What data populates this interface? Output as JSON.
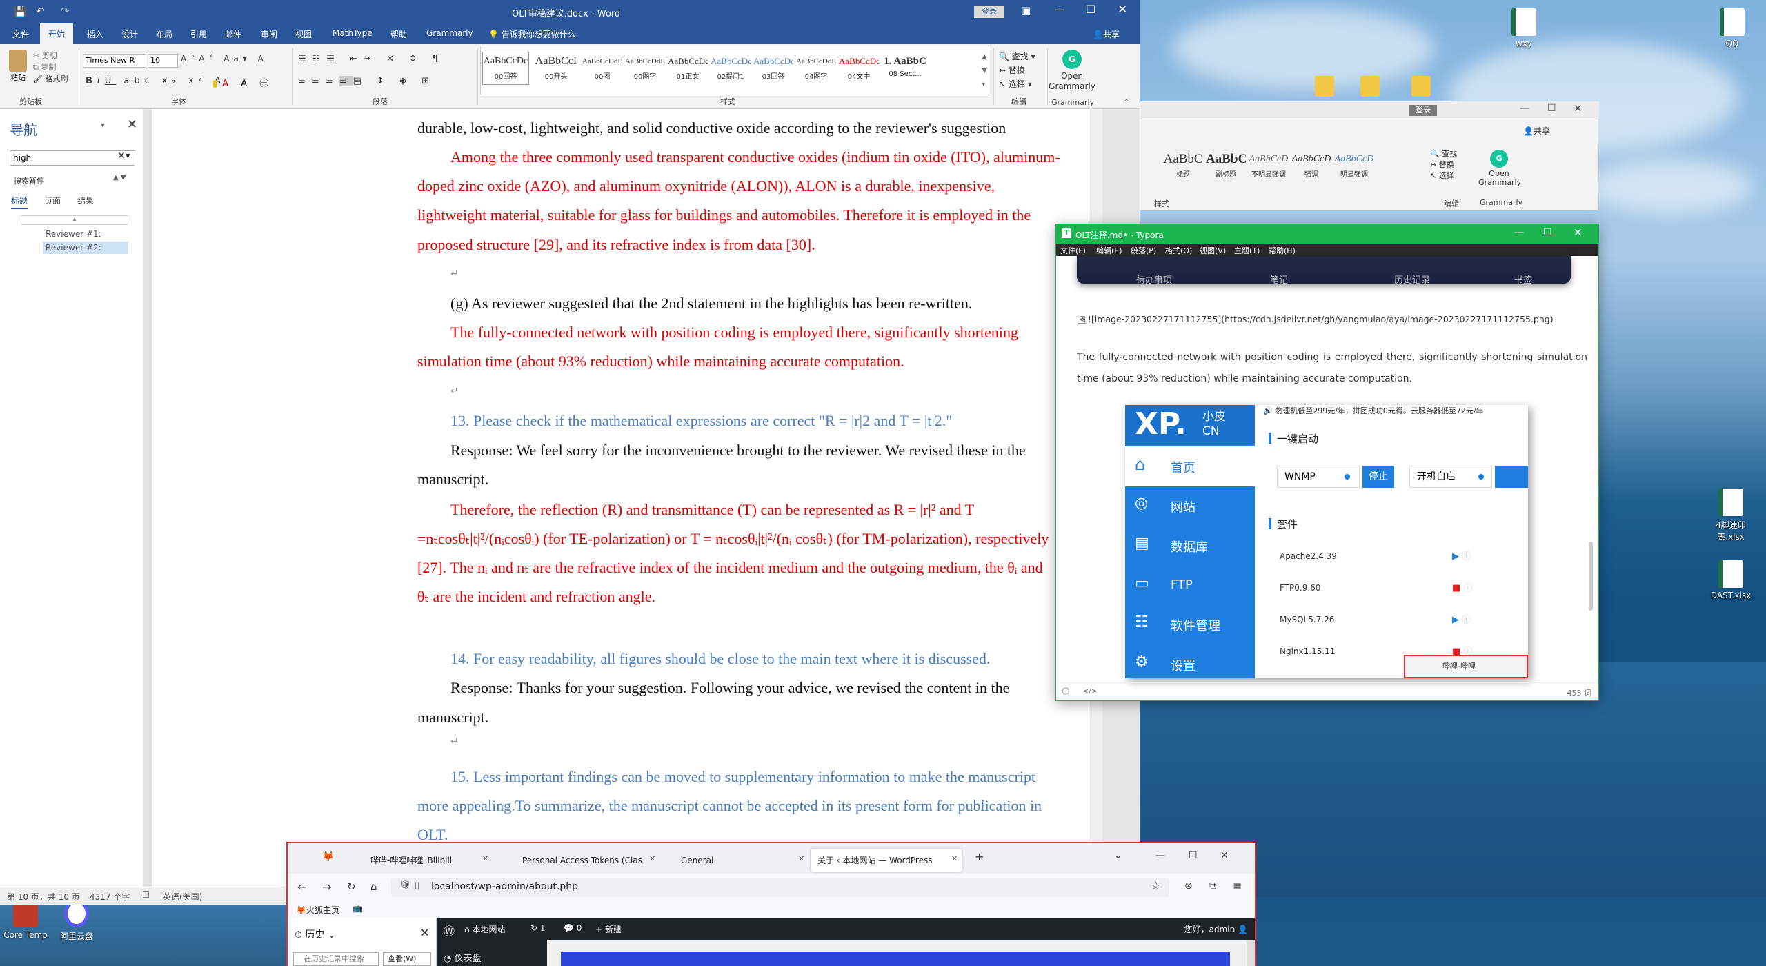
{
  "desktop": {
    "icons": [
      {
        "label": "wxy"
      },
      {
        "label": "QQ"
      },
      {
        "label": "4脚速印表.xlsx"
      },
      {
        "label": "DAST.xlsx"
      },
      {
        "label": "Core Temp"
      },
      {
        "label": "阿里云盘"
      }
    ]
  },
  "word": {
    "title": "OLT审稿建议.docx - Word",
    "login": "登录",
    "share": "共享",
    "tabs": [
      "文件",
      "开始",
      "插入",
      "设计",
      "布局",
      "引用",
      "邮件",
      "审阅",
      "视图",
      "MathType",
      "帮助",
      "Grammarly"
    ],
    "tell_me": "告诉我你想要做什么",
    "clipboard": {
      "paste": "粘贴",
      "cut": "剪切",
      "copy": "复制",
      "format_painter": "格式刷",
      "group": "剪贴板"
    },
    "font": {
      "name": "Times New R",
      "size": "10",
      "group": "字体"
    },
    "paragraph_group": "段落",
    "styles_group": "样式",
    "styles": [
      {
        "sample": "AaBbCcDc",
        "name": "00回答"
      },
      {
        "sample": "AaBbCcI",
        "name": "00开头"
      },
      {
        "sample": "AaBbCcDdE",
        "name": "00图"
      },
      {
        "sample": "AaBbCcDdE",
        "name": "00图字"
      },
      {
        "sample": "AaBbCcDc",
        "name": "01正文"
      },
      {
        "sample": "AaBbCcDc",
        "name": "02提问1"
      },
      {
        "sample": "AaBbCcDc",
        "name": "03回答"
      },
      {
        "sample": "AaBbCcDdE",
        "name": "04图字"
      },
      {
        "sample": "AaBbCcDc",
        "name": "04文中"
      },
      {
        "sample": "1. AaBbC",
        "name": "08 Sect..."
      }
    ],
    "editing": {
      "find": "查找",
      "replace": "替换",
      "select": "选择",
      "group": "编辑"
    },
    "grammarly": {
      "open": "Open Grammarly",
      "group": "Grammarly"
    },
    "nav": {
      "title": "导航",
      "search_value": "high",
      "search_paused": "搜索暂停",
      "tabs": [
        "标题",
        "页面",
        "结果"
      ],
      "headings": [
        "Reviewer #1:",
        "Reviewer #2:"
      ]
    },
    "doc": {
      "lines": [
        {
          "t": "durable, low-cost, lightweight, and solid conductive oxide  according to the reviewer's suggestion",
          "c": "black"
        },
        {
          "t": "Among the three commonly used transparent conductive oxides (indium tin oxide (ITO), aluminum-",
          "c": "red"
        },
        {
          "t": "doped  zinc  oxide  (AZO),  and  aluminum  oxynitride  (ALON)),  ALON  is  a  durable,  inexpensive,",
          "c": "red"
        },
        {
          "t": "lightweight material, suitable for glass for buildings and automobiles. Therefore it is employed in the",
          "c": "red"
        },
        {
          "t": "proposed structure [29], and its refractive index is from data [30].",
          "c": "red"
        },
        {
          "t": "(g) As reviewer suggested that the 2nd statement in the highlights has been re-written.",
          "c": "black"
        },
        {
          "t": "The  fully-connected  network  with  position  coding  is  employed  there,  significantly  shortening",
          "c": "red"
        },
        {
          "t": "simulation time (about 93% reduction) while maintaining accurate computation.",
          "c": "red"
        },
        {
          "t": "13. Please check if the mathematical expressions are correct \"R = |r|2 and T = |t|2.\"",
          "c": "blue"
        },
        {
          "t": "Response: We feel sorry for the inconvenience brought to the reviewer. We revised these in the",
          "c": "black"
        },
        {
          "t": "manuscript.",
          "c": "black"
        },
        {
          "t": "Therefore,  the  reflection  (R)  and  transmittance  (T)  can  be  represented  as  R  =  |r|²  and  T",
          "c": "red"
        },
        {
          "t": "=nₜcosθₜ|t|²/(nᵢcosθᵢ) (for TE-polarization) or T = nₜcosθᵢ|t|²/(nᵢ cosθₜ) (for TM-polarization), respectively",
          "c": "red"
        },
        {
          "t": "[27]. The nᵢ and nₜ are the refractive index of the incident medium and the outgoing medium, the θᵢ and",
          "c": "red"
        },
        {
          "t": "θₜ are the incident and refraction angle.",
          "c": "red"
        },
        {
          "t": "14. For easy readability, all figures should be close to the main text where it is discussed.",
          "c": "blue"
        },
        {
          "t": "Response: Thanks for your suggestion. Following your advice, we revised the content in the",
          "c": "black"
        },
        {
          "t": "manuscript.",
          "c": "black"
        },
        {
          "t": "15. Less important findings can be moved to supplementary information to make the manuscript",
          "c": "blue"
        },
        {
          "t": "more appealing.To summarize, the manuscript cannot be accepted in its present form for publication in",
          "c": "blue"
        },
        {
          "t": "OLT.",
          "c": "blue"
        }
      ]
    },
    "status": {
      "page": "第 10 页，共 10 页",
      "words": "4317 个字",
      "lang": "英语(美国)"
    }
  },
  "word2": {
    "login": "登录",
    "share": "共享",
    "styles": [
      {
        "sample": "AaBbC",
        "name": "标题"
      },
      {
        "sample": "AaBbC",
        "name": "副标题"
      },
      {
        "sample": "AaBbCcD",
        "name": "不明显强调"
      },
      {
        "sample": "AaBbCcD",
        "name": "强调"
      },
      {
        "sample": "AaBbCcD",
        "name": "明显强调"
      }
    ],
    "styles_group": "样式",
    "editing": {
      "find": "查找",
      "replace": "替换",
      "select": "选择",
      "group": "编辑"
    },
    "grammarly": {
      "open": "Open Grammarly",
      "group": "Grammarly"
    }
  },
  "typora": {
    "title": "OLT注释.md• - Typora",
    "menu": [
      "文件(F)",
      "编辑(E)",
      "段落(P)",
      "格式(O)",
      "视图(V)",
      "主题(T)",
      "帮助(H)"
    ],
    "top_labels": [
      "待办事项",
      "笔记",
      "历史记录",
      "书签"
    ],
    "image_link": "![image-20230227171112755](https://cdn.jsdelivr.net/gh/yangmulao/aya/image-20230227171112755.png)",
    "para": "The fully-connected network with position coding is employed there, significantly shortening simulation time (about 93% reduction) while maintaining accurate computation.",
    "xp": {
      "logo": "XP.",
      "logo_sub": "小皮",
      "logo_cn": "CN",
      "ad": "物理机低至299元/年，拼团成功0元得。云服务器低至72元/年",
      "nav": [
        "首页",
        "网站",
        "数据库",
        "FTP",
        "软件管理",
        "设置"
      ],
      "one_click": "一键启动",
      "wnmp": "WNMP",
      "stop": "停止",
      "autostart": "开机自启",
      "suite": "套件",
      "services": [
        "Apache2.4.39",
        "FTP0.9.60",
        "MySQL5.7.26",
        "Nginx1.15.11"
      ],
      "taskbar_item": "哔哩-哔哩"
    },
    "word_count": "453 词"
  },
  "firefox": {
    "tabs": [
      "哔哔-哔哩哔哩_Bilibili",
      "Personal Access Tokens (Clas",
      "General",
      "关于 ‹ 本地网站 — WordPress"
    ],
    "url": "localhost/wp-admin/about.php",
    "bookmark": "火狐主页",
    "history_title": "历史",
    "history_search": "在历史记录中搜索",
    "view": "查看(W)",
    "wp": {
      "site": "本地网站",
      "comments": "0",
      "updates": "1",
      "new": "新建",
      "greeting": "您好，admin",
      "dashboard": "仪表盘"
    }
  }
}
